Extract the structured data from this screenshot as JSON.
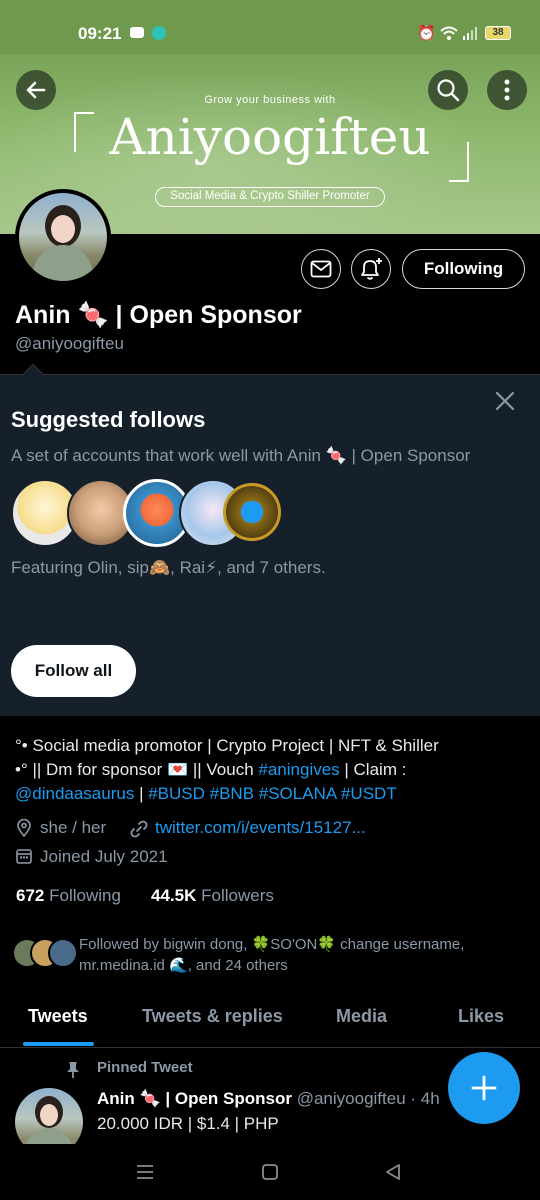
{
  "status_bar": {
    "time": "09:21",
    "battery": "38"
  },
  "banner": {
    "tagline": "Grow your business with",
    "title": "Aniyoogifteu",
    "subtitle": "Social Media & Crypto Shiller Promoter"
  },
  "profile": {
    "name": "Anin 🍬 | Open Sponsor",
    "handle": "@aniyoogifteu",
    "follow_button": "Following",
    "bio_line1": "°• Social media promotor | Crypto Project | NFT & Shiller",
    "bio_line2_prefix": "•° || Dm for sponsor 💌  || Vouch ",
    "bio_hashtag_aningives": "#aningives",
    "bio_line2_suffix": " | Claim :",
    "bio_mention": "@dindaasaurus",
    "bio_sep": " | ",
    "bio_tags": "#BUSD #BNB #SOLANA #USDT",
    "pronouns": "she / her",
    "website": "twitter.com/i/events/15127...",
    "joined": "Joined July 2021",
    "following_count": "672",
    "following_label": "Following",
    "followers_count": "44.5K",
    "followers_label": "Followers",
    "followed_by": "Followed by bigwin dong, 🍀SO'ON🍀 change username, mr.medina.id 🌊, and 24 others"
  },
  "suggested": {
    "title": "Suggested follows",
    "description": "A set of accounts that work well with Anin 🍬 | Open Sponsor",
    "featuring": "Featuring Olin, sip🙈, Rai⚡, and 7 others.",
    "follow_all": "Follow all"
  },
  "tabs": [
    "Tweets",
    "Tweets & replies",
    "Media",
    "Likes"
  ],
  "pinned": {
    "label": "Pinned Tweet",
    "name": "Anin 🍬 | Open Sponsor",
    "handle": "@aniyoogifteu",
    "time": "· 4h",
    "text": "20.000 IDR | $1.4 | PHP"
  },
  "colors": {
    "accent": "#1d9bf0",
    "banner_green": "#8db86c",
    "card_bg": "#15202b"
  }
}
